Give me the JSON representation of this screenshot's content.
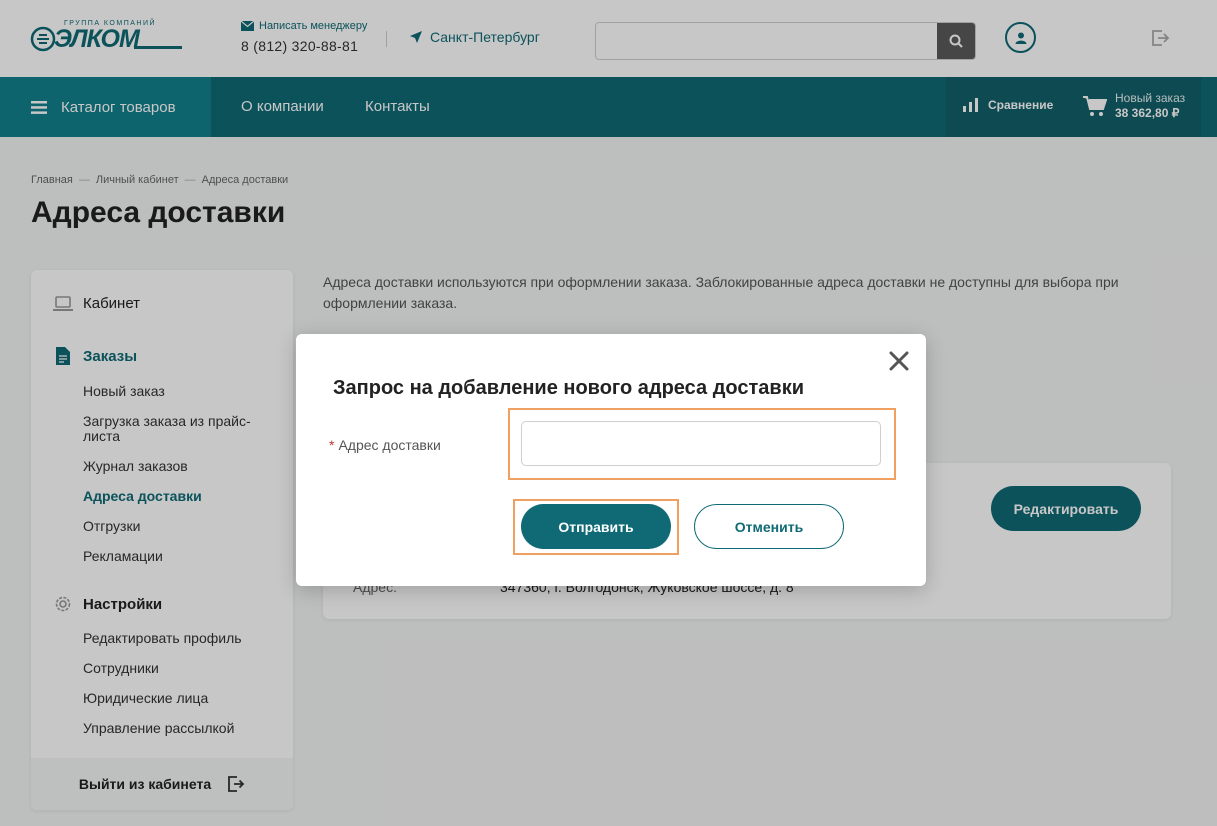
{
  "colors": {
    "brand": "#0f6a75",
    "highlight": "#f0a060"
  },
  "header": {
    "logo": {
      "top_text": "ГРУППА КОМПАНИЙ",
      "word": "ЭЛКОМ",
      "icon": "elkom-logo-icon"
    },
    "mail_label": "Написать менеджеру",
    "phone": "8 (812) 320-88-81",
    "city": "Санкт-Петербург",
    "search": {
      "value": "",
      "placeholder": ""
    }
  },
  "nav": {
    "catalog": "Каталог товаров",
    "links": [
      "О компании",
      "Контакты"
    ],
    "compare": "Сравнение",
    "cart": {
      "title": "Новый заказ",
      "sum": "38 362,80 ₽"
    }
  },
  "breadcrumb": [
    "Главная",
    "Личный кабинет",
    "Адреса доставки"
  ],
  "breadcrumb_sep": "—",
  "page_title": "Адреса доставки",
  "sidebar": {
    "cabinet": "Кабинет",
    "orders": "Заказы",
    "order_items": [
      "Новый заказ",
      "Загрузка заказа из прайс-листа",
      "Журнал заказов",
      "Адреса доставки",
      "Отгрузки",
      "Рекламации"
    ],
    "settings": "Настройки",
    "settings_items": [
      "Редактировать профиль",
      "Сотрудники",
      "Юридические лица",
      "Управление рассылкой"
    ],
    "logout": "Выйти из кабинета"
  },
  "main": {
    "intro": "Адреса доставки используются при оформлении заказа. Заблокированные адреса доставки не доступны для выбора при оформлении заказа.",
    "card": {
      "edit_label": "Редактировать",
      "address_label": "Адрес:",
      "address_value": "347360, г. Волгодонск, Жуковское шоссе, д. 8"
    }
  },
  "modal": {
    "title": "Запрос на добавление нового адреса доставки",
    "required_mark": "*",
    "field_label": "Адрес доставки",
    "field_value": "",
    "field_placeholder": "",
    "submit": "Отправить",
    "cancel": "Отменить"
  }
}
